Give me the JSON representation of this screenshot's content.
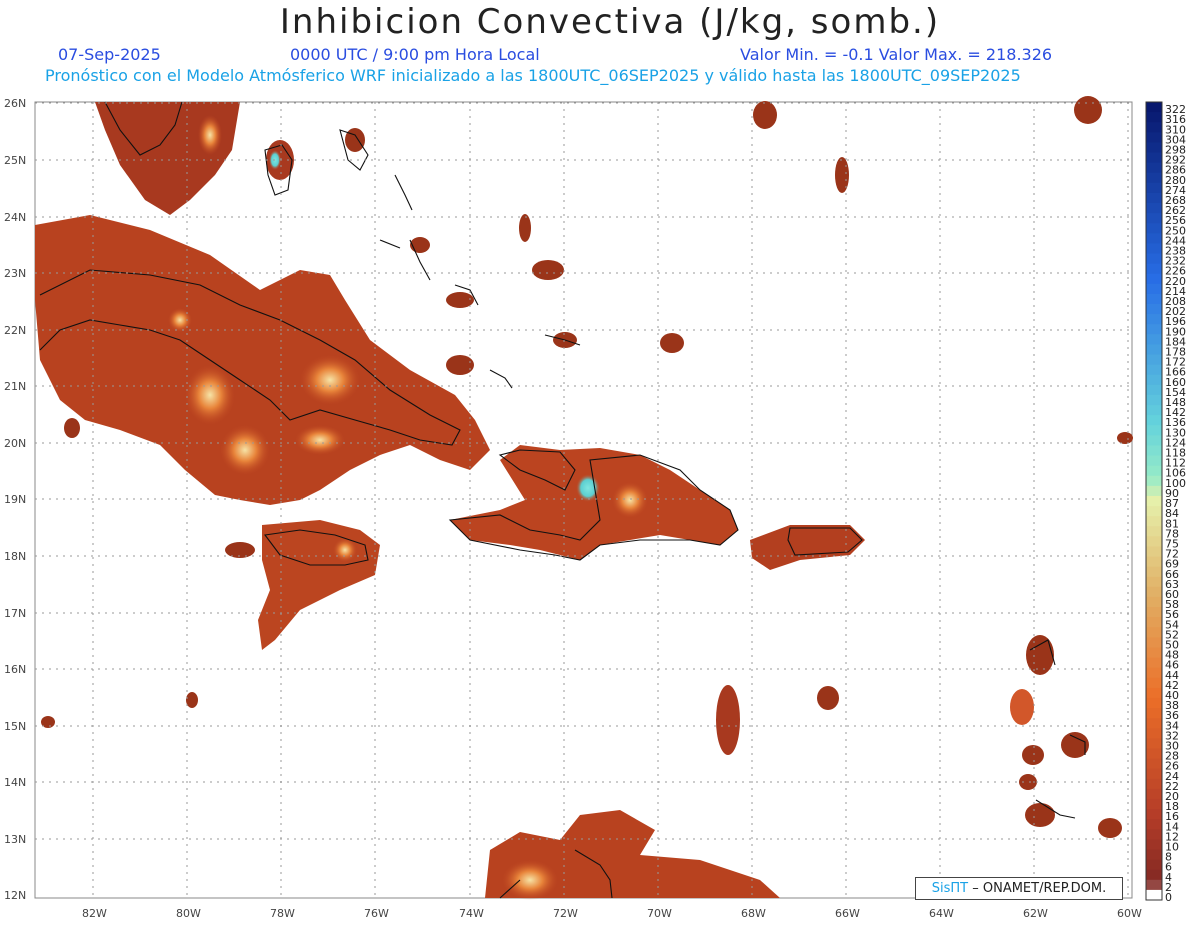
{
  "header": {
    "title": "Inhibicion Convectiva (J/kg, somb.)",
    "date": "07-Sep-2025",
    "time": "0000 UTC / 9:00 pm Hora Local",
    "min_max": "Valor Min. = -0.1  Valor Max. = 218.326",
    "model_info": "Pronóstico con el Modelo Atmósferico WRF inicializado a las 1800UTC_06SEP2025 y válido hasta las  1800UTC_09SEP2025"
  },
  "map": {
    "lat_labels": [
      "26N",
      "25N",
      "24N",
      "23N",
      "22N",
      "21N",
      "20N",
      "19N",
      "18N",
      "17N",
      "16N",
      "15N",
      "14N",
      "13N",
      "12N"
    ],
    "lon_labels": [
      "82W",
      "80W",
      "78W",
      "76W",
      "74W",
      "72W",
      "70W",
      "68W",
      "66W",
      "64W",
      "62W",
      "60W"
    ],
    "field_color_low": "#8b2e1a",
    "field_color_mid": "#e0622a",
    "field_color_high": "#f3d28a"
  },
  "colorbar": {
    "labels": [
      "322",
      "316",
      "310",
      "304",
      "298",
      "292",
      "286",
      "280",
      "274",
      "268",
      "262",
      "256",
      "250",
      "244",
      "238",
      "232",
      "226",
      "220",
      "214",
      "208",
      "202",
      "196",
      "190",
      "184",
      "178",
      "172",
      "166",
      "160",
      "154",
      "148",
      "142",
      "136",
      "130",
      "124",
      "118",
      "112",
      "106",
      "100",
      "90",
      "87",
      "84",
      "81",
      "78",
      "75",
      "72",
      "69",
      "66",
      "63",
      "60",
      "58",
      "56",
      "54",
      "52",
      "50",
      "48",
      "46",
      "44",
      "42",
      "40",
      "38",
      "36",
      "34",
      "32",
      "30",
      "28",
      "26",
      "24",
      "22",
      "20",
      "18",
      "16",
      "14",
      "12",
      "10",
      "8",
      "6",
      "4",
      "2",
      "0"
    ]
  },
  "credit": {
    "brand": "SisПТ",
    "text": " – ONAMET/REP.DOM."
  }
}
